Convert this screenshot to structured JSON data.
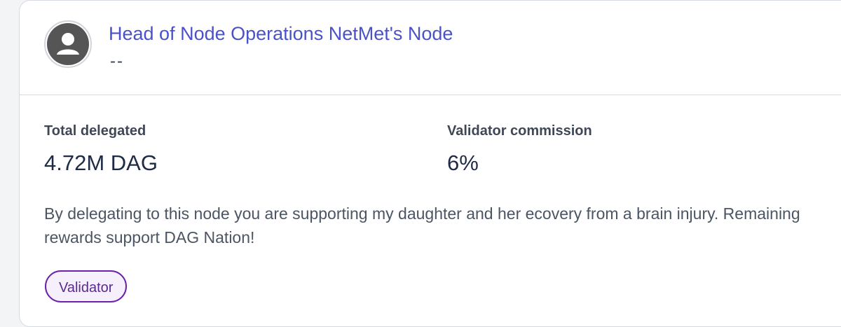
{
  "node": {
    "name": "Head of Node Operations NetMet's Node",
    "subtitle": "--",
    "avatar_icon": "user-avatar-icon"
  },
  "stats": {
    "total_delegated": {
      "label": "Total delegated",
      "value": "4.72M DAG"
    },
    "validator_commission": {
      "label": "Validator commission",
      "value": "6%"
    }
  },
  "description": "By delegating to this node you are supporting my daughter and her ecovery from a brain injury. Remaining rewards support DAG Nation!",
  "badge": {
    "label": "Validator"
  },
  "colors": {
    "link": "#4a52c9",
    "badge_border": "#6b21a8",
    "badge_text": "#5b2a8e",
    "badge_bg": "#f5f0fb"
  }
}
